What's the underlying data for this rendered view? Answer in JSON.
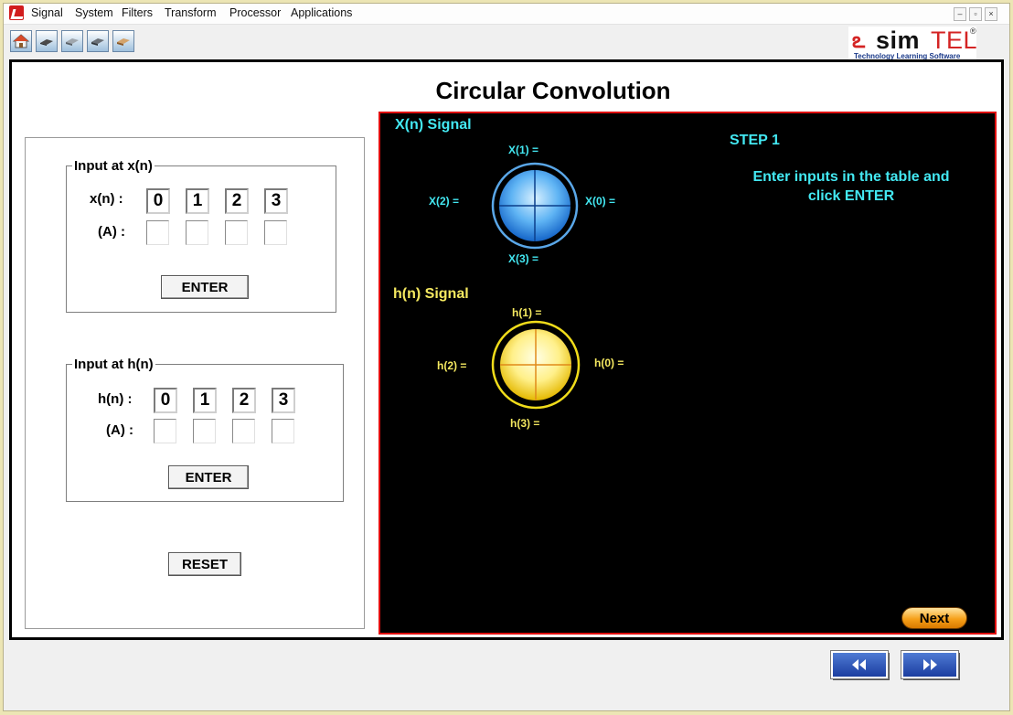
{
  "menu": [
    "Signal",
    "System",
    "Filters",
    "Transform",
    "Processor",
    "Applications"
  ],
  "window_controls": {
    "minimize": "–",
    "restore": "▫",
    "close": "×"
  },
  "toolbar": {
    "icons": [
      "home-icon",
      "signal-tool-icon",
      "system-tool-icon",
      "processor-tool-icon",
      "application-tool-icon"
    ]
  },
  "logo": {
    "mark": "ఽ",
    "word_bold": "sim",
    "word_light": "TEL",
    "reg": "®",
    "tagline": "Technology Learning Software"
  },
  "page_title": "Circular Convolution",
  "xn_group": {
    "legend": "Input at x(n)",
    "row1_label": "x(n) :",
    "row2_label": "(A) :",
    "indices": [
      "0",
      "1",
      "2",
      "3"
    ],
    "inputs": [
      "",
      "",
      "",
      ""
    ],
    "enter_label": "ENTER"
  },
  "hn_group": {
    "legend": "Input at h(n)",
    "row1_label": "h(n) :",
    "row2_label": "(A) :",
    "indices": [
      "0",
      "1",
      "2",
      "3"
    ],
    "inputs": [
      "",
      "",
      "",
      ""
    ],
    "enter_label": "ENTER"
  },
  "reset_label": "RESET",
  "stage": {
    "x_title": "X(n) Signal",
    "x_labels": {
      "top": "X(1) =",
      "left": "X(2) =",
      "right": "X(0) =",
      "bottom": "X(3) ="
    },
    "h_title": "h(n) Signal",
    "h_labels": {
      "top": "h(1) =",
      "left": "h(2) =",
      "right": "h(0) =",
      "bottom": "h(3) ="
    },
    "step_title": "STEP 1",
    "step_line1": "Enter inputs in the table and",
    "step_line2": "click  ENTER",
    "next_label": "Next"
  },
  "nav": {
    "back_icon": "rewind-icon",
    "forward_icon": "fast-forward-icon"
  },
  "colors": {
    "cyan_text": "#43e8f2",
    "yellow_text": "#f5e960",
    "stage_border": "#e01010",
    "nav_blue": "#1b3da0"
  }
}
